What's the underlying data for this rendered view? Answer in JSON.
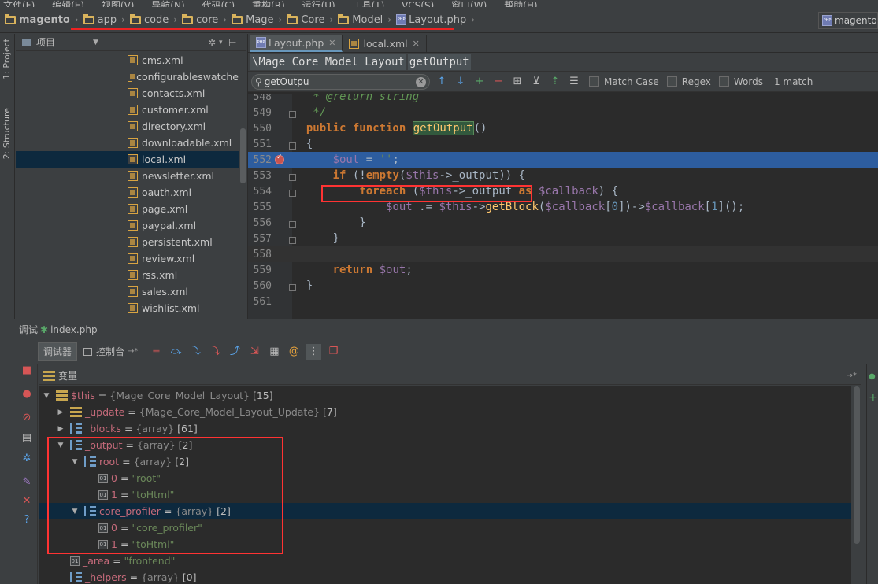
{
  "menu": [
    "文件(F)",
    "编辑(E)",
    "视图(V)",
    "导航(N)",
    "代码(C)",
    "重构(R)",
    "运行(U)",
    "工具(T)",
    "VCS(S)",
    "窗口(W)",
    "帮助(H)"
  ],
  "breadcrumb": {
    "project": "magento",
    "items": [
      "app",
      "code",
      "core",
      "Mage",
      "Core",
      "Model"
    ],
    "file": "Layout.php",
    "right_project": "magento"
  },
  "left_tabs": {
    "project": "1: Project",
    "structure": "2: Structure"
  },
  "project_panel": {
    "title": "项目",
    "files": [
      "cms.xml",
      "configurableswatche",
      "contacts.xml",
      "customer.xml",
      "directory.xml",
      "downloadable.xml",
      "local.xml",
      "newsletter.xml",
      "oauth.xml",
      "page.xml",
      "paypal.xml",
      "persistent.xml",
      "review.xml",
      "rss.xml",
      "sales.xml",
      "wishlist.xml"
    ],
    "selected": "local.xml"
  },
  "editor": {
    "tabs": [
      {
        "label": "Layout.php",
        "active": true
      },
      {
        "label": "local.xml",
        "active": false
      }
    ],
    "crumbs": [
      "\\Mage_Core_Model_Layout",
      "getOutput"
    ],
    "search": {
      "value": "getOutpu",
      "match_case": "Match Case",
      "regex": "Regex",
      "words": "Words",
      "result": "1 match"
    },
    "lines": [
      {
        "no": "548",
        "text": "   * @return string"
      },
      {
        "no": "549",
        "text": "   */"
      },
      {
        "no": "550",
        "text": "  public function getOutput()"
      },
      {
        "no": "551",
        "text": "  {"
      },
      {
        "no": "552",
        "text": "      $out = '';"
      },
      {
        "no": "553",
        "text": "      if (!empty($this->_output)) {"
      },
      {
        "no": "554",
        "text": "          foreach ($this->_output as $callback) {"
      },
      {
        "no": "555",
        "text": "              $out .= $this->getBlock($callback[0])->$callback[1]();"
      },
      {
        "no": "556",
        "text": "          }"
      },
      {
        "no": "557",
        "text": "      }"
      },
      {
        "no": "558",
        "text": ""
      },
      {
        "no": "559",
        "text": "      return $out;"
      },
      {
        "no": "560",
        "text": "  }"
      },
      {
        "no": "561",
        "text": ""
      }
    ]
  },
  "debug": {
    "title_prefix": "调试",
    "file": "index.php",
    "tabs": [
      "调试器",
      "控制台"
    ],
    "vars_title": "变量",
    "vars": [
      {
        "name": "$this",
        "type": "{Mage_Core_Model_Layout}",
        "count": "[15]"
      },
      {
        "name": "_update",
        "type": "{Mage_Core_Model_Layout_Update}",
        "count": "[7]"
      },
      {
        "name": "_blocks",
        "type": "{array}",
        "count": "[61]"
      },
      {
        "name": "_output",
        "type": "{array}",
        "count": "[2]"
      },
      {
        "name": "root",
        "type": "{array}",
        "count": "[2]"
      },
      {
        "name": "0",
        "value": "\"root\""
      },
      {
        "name": "1",
        "value": "\"toHtml\""
      },
      {
        "name": "core_profiler",
        "type": "{array}",
        "count": "[2]"
      },
      {
        "name": "0",
        "value": "\"core_profiler\""
      },
      {
        "name": "1",
        "value": "\"toHtml\""
      },
      {
        "name": "_area",
        "value": "\"frontend\""
      },
      {
        "name": "_helpers",
        "type": "{array}",
        "count": "[0]"
      }
    ]
  },
  "colors": {
    "highlight_red": "#ff3333",
    "current_line": "#2d5d9f",
    "selection": "#0d293e"
  }
}
